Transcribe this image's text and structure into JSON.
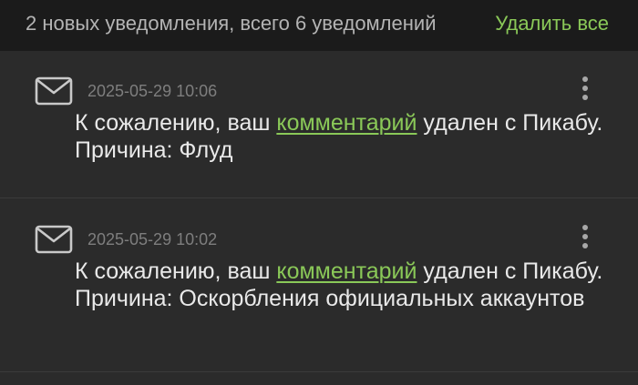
{
  "header": {
    "summary": "2 новых уведомления, всего 6 уведомлений",
    "delete_all_label": "Удалить все"
  },
  "colors": {
    "accent": "#8ac858",
    "background": "#1b1b1b",
    "card": "#2b2b2b",
    "text": "#e9e9e9",
    "muted": "#7e7e7e"
  },
  "notifications": [
    {
      "icon": "envelope-icon",
      "date": "2025-05-29 10:06",
      "text_before": "К сожалению, ваш ",
      "link": "комментарий",
      "text_after": " удален с Пикабу. Причина: Флуд"
    },
    {
      "icon": "envelope-icon",
      "date": "2025-05-29 10:02",
      "text_before": "К сожалению, ваш ",
      "link": "комментарий",
      "text_after": " удален с Пикабу. Причина: Оскорбления официальных аккаунтов"
    }
  ]
}
